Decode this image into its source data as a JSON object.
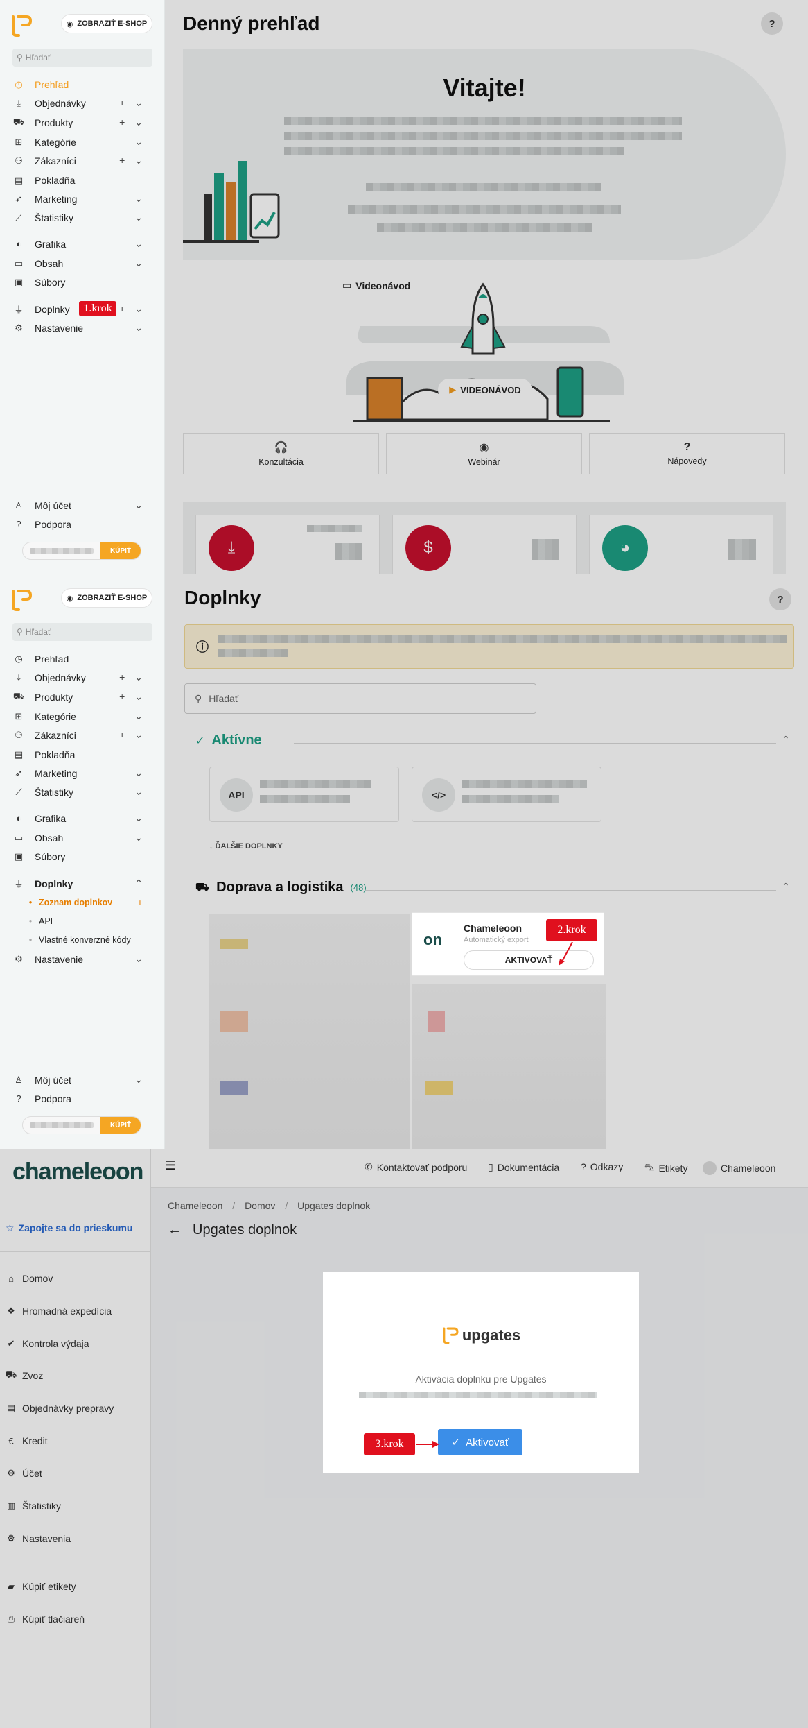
{
  "panel1": {
    "eshop_button": "ZOBRAZIŤ E-SHOP",
    "search_placeholder": "Hľadať",
    "nav": [
      {
        "label": "Prehľad",
        "icon": "dashboard-icon",
        "ctrl": ""
      },
      {
        "label": "Objednávky",
        "icon": "download-tray-icon",
        "ctrl": "+⌄"
      },
      {
        "label": "Produkty",
        "icon": "box-icon",
        "ctrl": "+⌄"
      },
      {
        "label": "Kategórie",
        "icon": "category-icon",
        "ctrl": "⌄"
      },
      {
        "label": "Zákazníci",
        "icon": "users-icon",
        "ctrl": "+⌄"
      },
      {
        "label": "Pokladňa",
        "icon": "register-icon",
        "ctrl": ""
      },
      {
        "label": "Marketing",
        "icon": "rocket-icon",
        "ctrl": "⌄"
      },
      {
        "label": "Štatistiky",
        "icon": "chart-icon",
        "ctrl": "⌄"
      },
      {
        "label": "Grafika",
        "icon": "palette-icon",
        "ctrl": "⌄"
      },
      {
        "label": "Obsah",
        "icon": "content-icon",
        "ctrl": "⌄"
      },
      {
        "label": "Súbory",
        "icon": "image-icon",
        "ctrl": ""
      },
      {
        "label": "Doplnky",
        "icon": "plug-icon",
        "ctrl": "+⌄"
      },
      {
        "label": "Nastavenie",
        "icon": "gear-icon",
        "ctrl": "⌄"
      }
    ],
    "account": "Môj účet",
    "support": "Podpora",
    "buy_label": "KÚPIŤ",
    "step1": "1.krok",
    "title": "Denný prehľad",
    "help": "?",
    "welcome": "Vitajte!",
    "video_label": "Videonávod",
    "video_button": "VIDEONÁVOD",
    "actions": [
      {
        "label": "Konzultácia",
        "icon": "headset-icon"
      },
      {
        "label": "Webinár",
        "icon": "webcam-icon"
      },
      {
        "label": "Nápovedy",
        "icon": "question-icon"
      }
    ]
  },
  "panel2": {
    "title": "Doplnky",
    "search_placeholder": "Hľadať",
    "active_section": "Aktívne",
    "api_label": "API",
    "more_addons": "↓ ĎALŠIE DOPLNKY",
    "logistics_section": "Doprava a logistika",
    "logistics_count": "(48)",
    "chameleoon_name": "Chameleoon",
    "chameleoon_desc": "Automatický export",
    "activate_button": "AKTIVOVAŤ",
    "step2": "2.krok",
    "sub_nav": [
      "Zoznam doplnkov",
      "API",
      "Vlastné konverzné kódy"
    ]
  },
  "panel3": {
    "logo": "chameleoon",
    "survey": "Zapojte sa do prieskumu",
    "menu": [
      {
        "label": "Domov",
        "icon": "home-icon"
      },
      {
        "label": "Hromadná expedícia",
        "icon": "stack-icon"
      },
      {
        "label": "Kontrola výdaja",
        "icon": "check-icon"
      },
      {
        "label": "Zvoz",
        "icon": "truck-icon"
      },
      {
        "label": "Objednávky prepravy",
        "icon": "document-icon"
      },
      {
        "label": "Kredit",
        "icon": "credit-icon"
      },
      {
        "label": "Účet",
        "icon": "account-icon"
      },
      {
        "label": "Štatistiky",
        "icon": "chart-icon"
      },
      {
        "label": "Nastavenia",
        "icon": "gear-icon"
      }
    ],
    "buy_labels": "Kúpiť etikety",
    "buy_printer": "Kúpiť tlačiareň",
    "top_links": [
      {
        "label": "Kontaktovať podporu",
        "icon": "phone-icon"
      },
      {
        "label": "Dokumentácia",
        "icon": "book-icon"
      },
      {
        "label": "Odkazy",
        "icon": "help-icon"
      },
      {
        "label": "Etikety",
        "icon": "cart-icon"
      },
      {
        "label": "Chameleoon",
        "icon": "user-icon"
      }
    ],
    "breadcrumb": [
      "Chameleoon",
      "Domov",
      "Upgates doplnok"
    ],
    "page_title": "Upgates doplnok",
    "upgates_logo": "upgates",
    "activation_text": "Aktivácia doplnku pre Upgates",
    "activate": "Aktivovať",
    "step3": "3.krok"
  }
}
